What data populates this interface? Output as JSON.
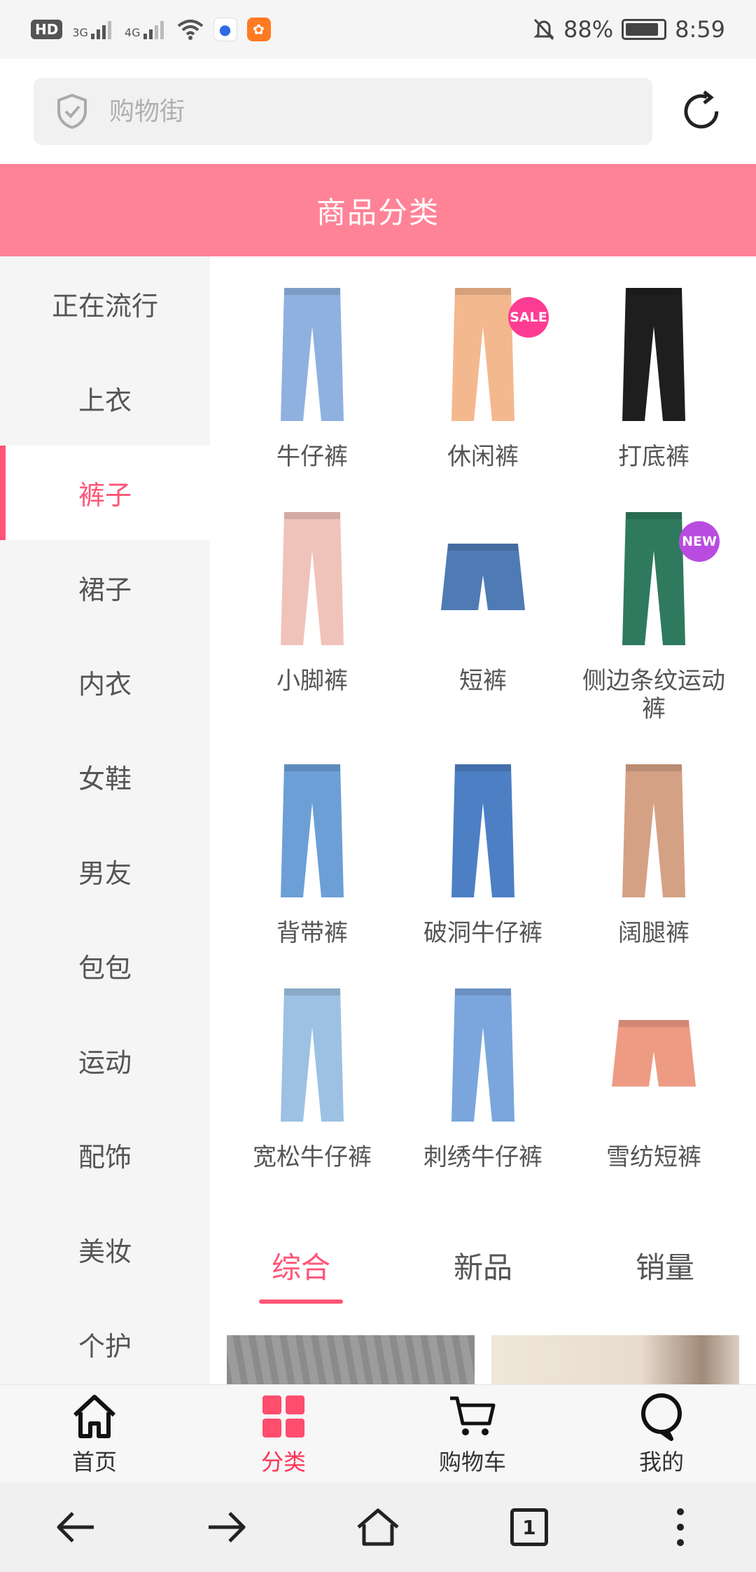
{
  "status_bar": {
    "left_badges": [
      "HD",
      "3G",
      "4G"
    ],
    "battery_percent": "88%",
    "battery_level": 0.88,
    "time": "8:59",
    "icons": [
      "hd-icon",
      "signal-3g-icon",
      "signal-4g-icon",
      "wifi-icon",
      "baidu-icon",
      "uc-browser-icon",
      "mute-icon",
      "battery-icon"
    ]
  },
  "search": {
    "placeholder": "购物街",
    "shield_icon": "shield-icon",
    "refresh_icon": "refresh-icon"
  },
  "header": {
    "title": "商品分类"
  },
  "sidebar": {
    "items": [
      {
        "label": "正在流行"
      },
      {
        "label": "上衣"
      },
      {
        "label": "裤子",
        "active": true
      },
      {
        "label": "裙子"
      },
      {
        "label": "内衣"
      },
      {
        "label": "女鞋"
      },
      {
        "label": "男友"
      },
      {
        "label": "包包"
      },
      {
        "label": "运动"
      },
      {
        "label": "配饰"
      },
      {
        "label": "美妆"
      },
      {
        "label": "个护"
      }
    ]
  },
  "categories": [
    {
      "label": "牛仔裤",
      "color": "#8fb1df"
    },
    {
      "label": "休闲裤",
      "color": "#f4b88f",
      "tag": "SALE",
      "tag_color": "#ff3c93"
    },
    {
      "label": "打底裤",
      "color": "#1e1e1e"
    },
    {
      "label": "小脚裤",
      "color": "#f0c3ba"
    },
    {
      "label": "短裤",
      "color": "#4f7bb5"
    },
    {
      "label": "侧边条纹运动裤",
      "color": "#2f7a5e",
      "tag": "NEW",
      "tag_color": "#b84ce0"
    },
    {
      "label": "背带裤",
      "color": "#6c9fd6"
    },
    {
      "label": "破洞牛仔裤",
      "color": "#4d7fc4"
    },
    {
      "label": "阔腿裤",
      "color": "#d4a185"
    },
    {
      "label": "宽松牛仔裤",
      "color": "#9cc1e3"
    },
    {
      "label": "刺绣牛仔裤",
      "color": "#7aa6dd"
    },
    {
      "label": "雪纺短裤",
      "color": "#ee9b84"
    }
  ],
  "sort_tabs": [
    {
      "label": "综合",
      "active": true
    },
    {
      "label": "新品"
    },
    {
      "label": "销量"
    }
  ],
  "tab_bar": [
    {
      "label": "首页",
      "icon": "home-icon"
    },
    {
      "label": "分类",
      "icon": "category-icon",
      "active": true
    },
    {
      "label": "购物车",
      "icon": "cart-icon"
    },
    {
      "label": "我的",
      "icon": "profile-icon"
    }
  ],
  "nav_bar": {
    "tab_count": "1",
    "icons": [
      "back-arrow-icon",
      "forward-arrow-icon",
      "home-icon",
      "tabs-icon",
      "more-icon"
    ]
  },
  "colors": {
    "accent": "#ff5577",
    "header_bg": "#ff8397"
  }
}
